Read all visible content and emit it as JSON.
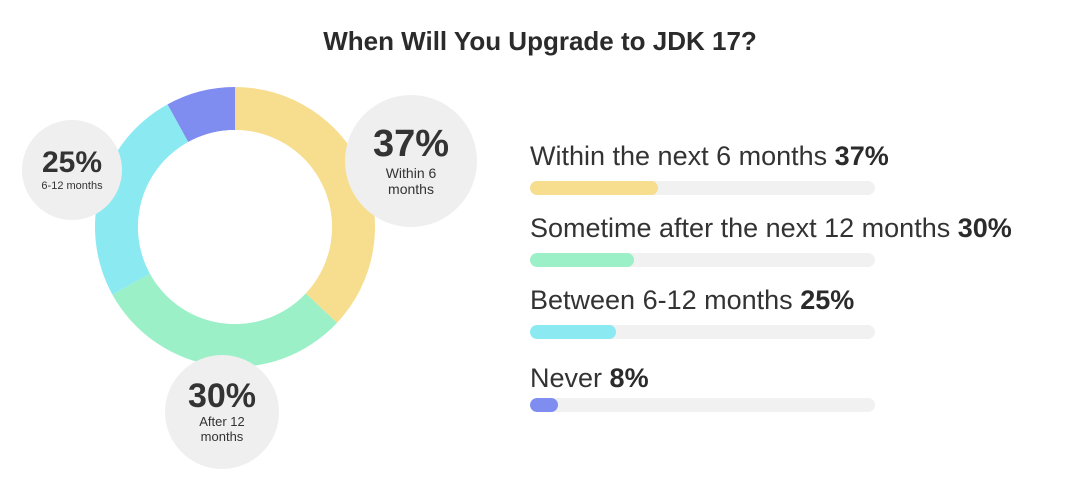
{
  "title": "When Will You Upgrade to JDK 17?",
  "colors": {
    "within6": "#f7dd8e",
    "after12": "#9bf0c8",
    "between": "#8be9f2",
    "never": "#7f8cf0"
  },
  "bubbles": {
    "within6": {
      "pct": "37%",
      "label_lines": [
        "Within 6",
        "months"
      ]
    },
    "after12": {
      "pct": "30%",
      "label_lines": [
        "After 12",
        "months"
      ]
    },
    "between": {
      "pct": "25%",
      "label_lines": [
        "6-12 months"
      ]
    }
  },
  "legend": [
    {
      "label": "Within the next 6 months",
      "pct": "37%"
    },
    {
      "label": "Sometime after the next 12 months",
      "pct": "30%"
    },
    {
      "label": "Between 6-12 months",
      "pct": "25%"
    },
    {
      "label": "Never",
      "pct": "8%"
    }
  ],
  "chart_data": {
    "type": "pie",
    "title": "When Will You Upgrade to JDK 17?",
    "categories": [
      "Within the next 6 months",
      "Sometime after the next 12 months",
      "Between 6-12 months",
      "Never"
    ],
    "values": [
      37,
      30,
      25,
      8
    ],
    "unit": "%"
  }
}
